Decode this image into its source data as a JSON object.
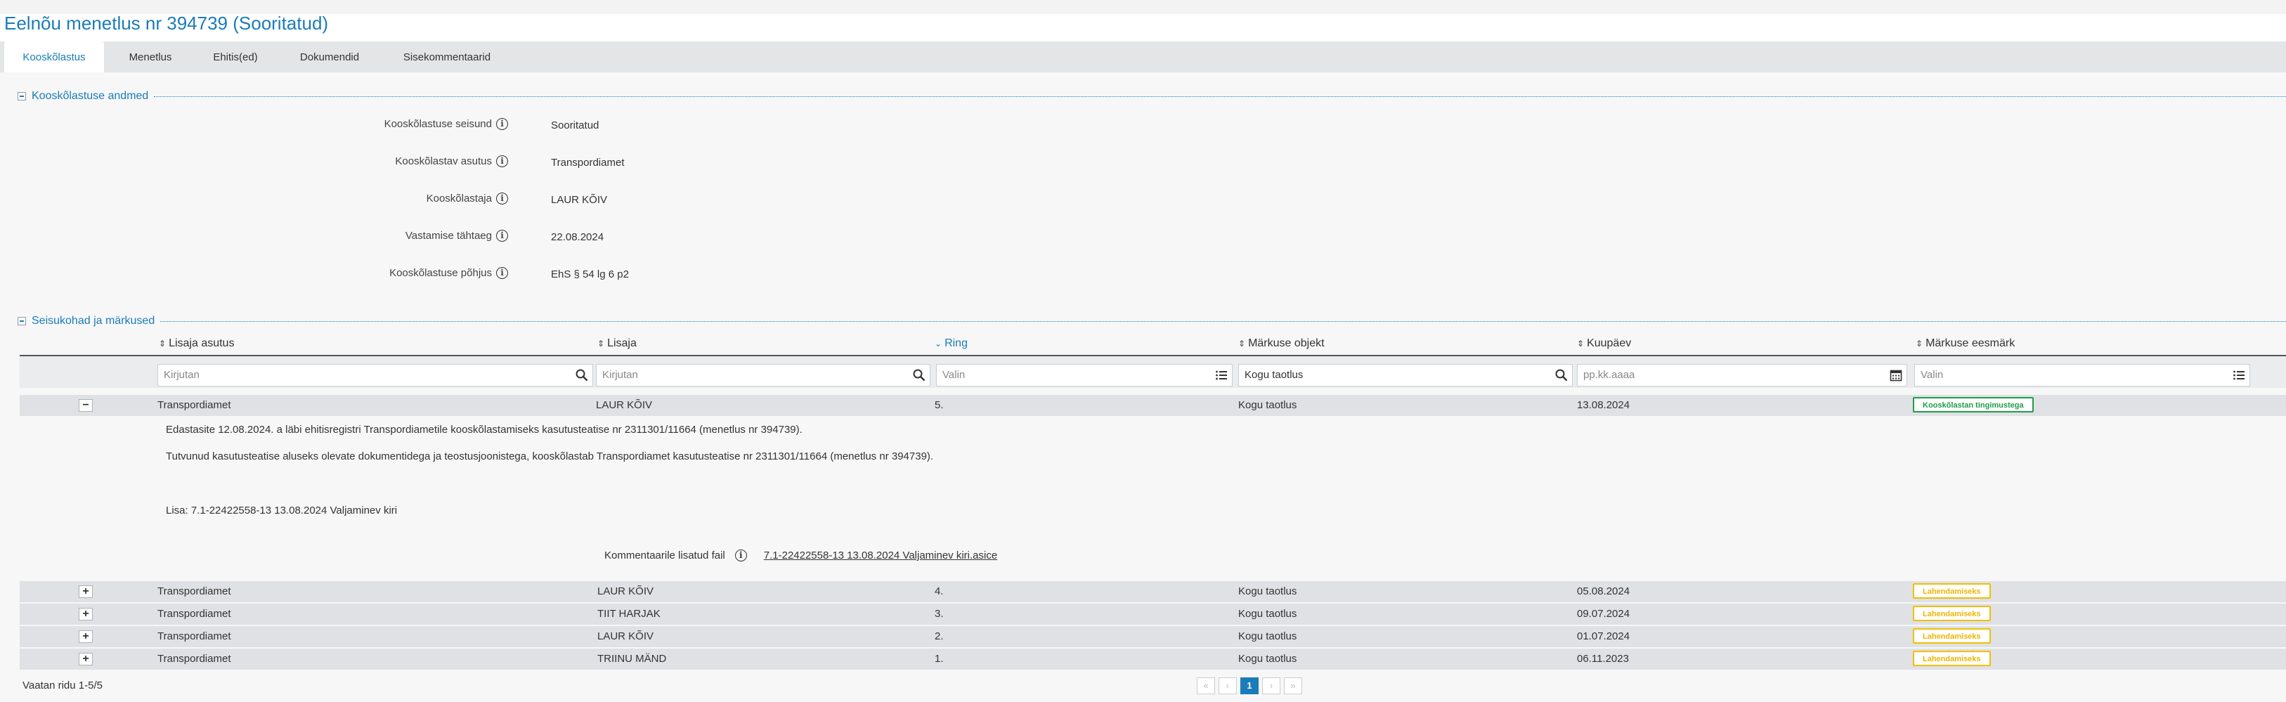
{
  "page": {
    "title": "Eelnõu menetlus nr 394739 (Sooritatud)"
  },
  "tabs": [
    {
      "label": "Kooskõlastus",
      "active": true
    },
    {
      "label": "Menetlus"
    },
    {
      "label": "Ehitis(ed)"
    },
    {
      "label": "Dokumendid"
    },
    {
      "label": "Sisekommentaarid"
    }
  ],
  "section1": {
    "title": "Kooskõlastuse andmed",
    "fields": [
      {
        "label": "Kooskõlastuse seisund",
        "value": "Sooritatud"
      },
      {
        "label": "Kooskõlastav asutus",
        "value": "Transpordiamet"
      },
      {
        "label": "Kooskõlastaja",
        "value": "LAUR KÕIV"
      },
      {
        "label": "Vastamise tähtaeg",
        "value": "22.08.2024"
      },
      {
        "label": "Kooskõlastuse põhjus",
        "value": "EhS § 54 lg 6 p2"
      }
    ]
  },
  "section2": {
    "title": "Seisukohad ja märkused",
    "columns": [
      "Lisaja asutus",
      "Lisaja",
      "Ring",
      "Märkuse objekt",
      "Kuupäev",
      "Märkuse eesmärk"
    ],
    "sorted_column": "Ring",
    "filters": [
      {
        "placeholder": "Kirjutan",
        "icon": "search-icon"
      },
      {
        "placeholder": "Kirjutan",
        "icon": "search-icon"
      },
      {
        "placeholder": "Valin",
        "icon": "list-icon"
      },
      {
        "value": "Kogu taotlus",
        "icon": "search-icon"
      },
      {
        "placeholder": "pp.kk.aaaa",
        "icon": "calendar-icon"
      },
      {
        "placeholder": "Valin",
        "icon": "list-icon"
      }
    ],
    "rows": [
      {
        "expanded": true,
        "asutus": "Transpordiamet",
        "lisaja": "LAUR KÕIV",
        "ring": "5.",
        "objekt": "Kogu taotlus",
        "kuupaev": "13.08.2024",
        "eesmark": "Kooskõlastan tingimustega",
        "eesmark_color": "#1e9e48"
      },
      {
        "asutus": "Transpordiamet",
        "lisaja": "LAUR KÕIV",
        "ring": "4.",
        "objekt": "Kogu taotlus",
        "kuupaev": "05.08.2024",
        "eesmark": "Lahendamiseks",
        "eesmark_color": "#f0b400"
      },
      {
        "asutus": "Transpordiamet",
        "lisaja": "TIIT HARJAK",
        "ring": "3.",
        "objekt": "Kogu taotlus",
        "kuupaev": "09.07.2024",
        "eesmark": "Lahendamiseks",
        "eesmark_color": "#f0b400"
      },
      {
        "asutus": "Transpordiamet",
        "lisaja": "LAUR KÕIV",
        "ring": "2.",
        "objekt": "Kogu taotlus",
        "kuupaev": "01.07.2024",
        "eesmark": "Lahendamiseks",
        "eesmark_color": "#f0b400"
      },
      {
        "asutus": "Transpordiamet",
        "lisaja": "TRIINU MÄND",
        "ring": "1.",
        "objekt": "Kogu taotlus",
        "kuupaev": "06.11.2023",
        "eesmark": "Lahendamiseks",
        "eesmark_color": "#f0b400"
      }
    ],
    "detail": {
      "line1": "Edastasite 12.08.2024. a läbi ehitisregistri Transpordiametile kooskõlastamiseks kasutusteatise nr 2311301/11664 (menetlus nr 394739).",
      "line2": "Tutvunud kasutusteatise aluseks olevate dokumentidega ja teostusjoonistega, kooskõlastab Transpordiamet kasutusteatise nr 2311301/11664 (menetlus nr 394739).",
      "attachment_line": "Lisa: 7.1-22422558-13 13.08.2024 Valjaminev kiri",
      "file_label": "Kommentaarile lisatud fail",
      "file_link": "7.1-22422558-13 13.08.2024 Valjaminev kiri.asice"
    },
    "footer": {
      "summary": "Vaatan ridu 1-5/5",
      "current_page": "1"
    }
  },
  "colors": {
    "accent": "#1a7cb8",
    "approve": "#1e9e48",
    "resolve": "#f0b400"
  }
}
